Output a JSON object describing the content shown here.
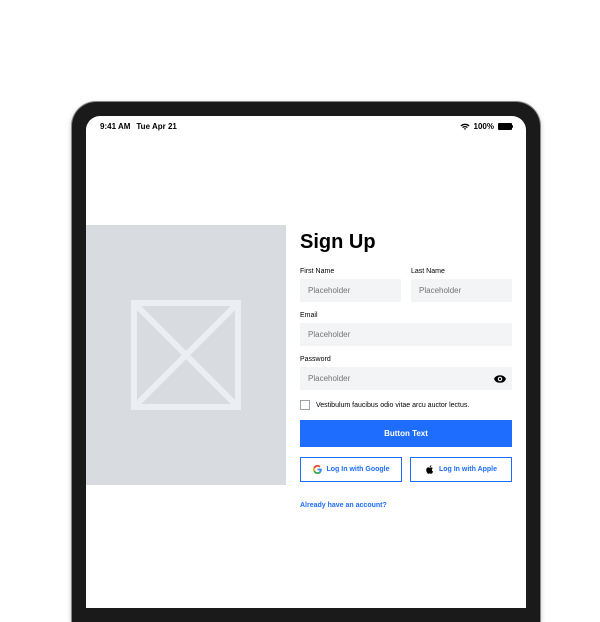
{
  "statusBar": {
    "time": "9:41 AM",
    "date": "Tue Apr 21",
    "batteryPercent": "100%"
  },
  "form": {
    "title": "Sign Up",
    "firstName": {
      "label": "First Name",
      "placeholder": "Placeholder"
    },
    "lastName": {
      "label": "Last Name",
      "placeholder": "Placeholder"
    },
    "email": {
      "label": "Email",
      "placeholder": "Placeholder"
    },
    "password": {
      "label": "Password",
      "placeholder": "Placeholder"
    },
    "checkbox": {
      "label": "Vestibulum faucibus odio vitae arcu auctor lectus."
    },
    "submitButton": "Button Text",
    "googleButton": "Log In with Google",
    "appleButton": "Log In with Apple",
    "accountLink": "Already have an account?"
  }
}
